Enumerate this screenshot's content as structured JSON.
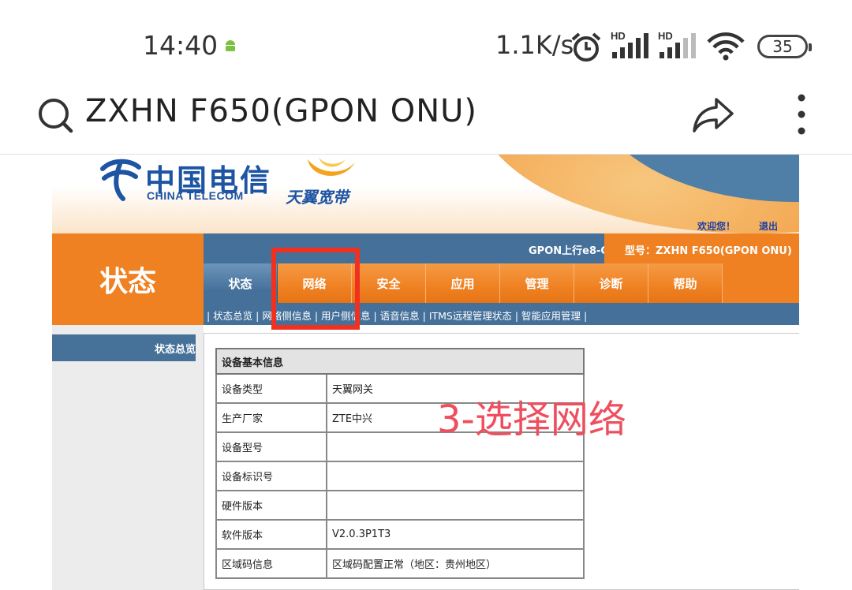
{
  "status_bar": {
    "time": "14:40",
    "net_speed": "1.1K/s",
    "battery": "35",
    "signal_label_1": "HD",
    "signal_label_2": "HD",
    "icons": [
      "android-icon",
      "alarm-icon",
      "signal-icon",
      "signal-icon",
      "wifi-icon",
      "battery-icon"
    ]
  },
  "browser": {
    "title": "ZXHN F650(GPON ONU)"
  },
  "router_page": {
    "header": {
      "logo_cn": "中国电信",
      "logo_en": "CHINA TELECOM",
      "tianyi": "天翼宽带",
      "welcome": "欢迎您！",
      "logout": "退出"
    },
    "left_title": "状态",
    "left_nav": [
      "状态总览"
    ],
    "gpon_text": "GPON上行e8-C",
    "model": "型号：ZXHN F650(GPON ONU)",
    "tabs": [
      {
        "label": "状态",
        "active": true
      },
      {
        "label": "网络",
        "active": false
      },
      {
        "label": "安全",
        "active": false
      },
      {
        "label": "应用",
        "active": false
      },
      {
        "label": "管理",
        "active": false
      },
      {
        "label": "诊断",
        "active": false
      },
      {
        "label": "帮助",
        "active": false
      }
    ],
    "subnav": "| 状态总览 | 网络侧信息 | 用户侧信息 | 语音信息 | ITMS远程管理状态 | 智能应用管理 |",
    "table": {
      "title": "设备基本信息",
      "rows": [
        {
          "key": "设备类型",
          "value": "天翼网关"
        },
        {
          "key": "生产厂家",
          "value": "ZTE中兴"
        },
        {
          "key": "设备型号",
          "value": ""
        },
        {
          "key": "设备标识号",
          "value": ""
        },
        {
          "key": "硬件版本",
          "value": ""
        },
        {
          "key": "软件版本",
          "value": "V2.0.3P1T3"
        },
        {
          "key": "区域码信息",
          "value": "区域码配置正常（地区：贵州地区）"
        }
      ]
    }
  },
  "annotation": {
    "text": "3-选择网络",
    "color": "#ee4f5e",
    "box_color": "#f0311f"
  }
}
